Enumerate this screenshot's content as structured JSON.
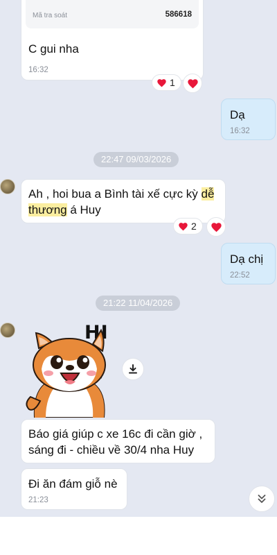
{
  "top_card": {
    "tracking_label": "Mã tra soát",
    "tracking_value": "586618",
    "message": "C gui nha",
    "time": "16:32",
    "reaction_count": "1"
  },
  "reply_1": {
    "text": "Dạ",
    "time": "16:32"
  },
  "date_1": "22:47 09/03/2026",
  "msg_2": {
    "text_before": "Ah , hoi bua a Bình tài xế cực kỳ ",
    "highlight_1": "dễ",
    "highlight_2": "thương",
    "text_after": " á Huy",
    "reaction_count": "2"
  },
  "reply_2": {
    "text": "Dạ chị",
    "time": "22:52"
  },
  "date_2": "21:22 11/04/2026",
  "sticker": {
    "caption": "HI"
  },
  "msg_3": {
    "line1": "Báo giá giúp c xe 16c đi cần giờ ,",
    "line2": "sáng đi - chiều về 30/4 nha Huy"
  },
  "msg_4": {
    "text": "Đi ăn đám giỗ nè",
    "time": "21:23"
  },
  "icons": {
    "heart": "heart-icon",
    "download": "download-icon",
    "scroll_down": "double-chevron-down-icon"
  },
  "colors": {
    "chat_background": "#e4e8f2",
    "my_bubble": "#d7ecfb",
    "heart": "#e8173a",
    "highlight": "#fbeea0"
  }
}
